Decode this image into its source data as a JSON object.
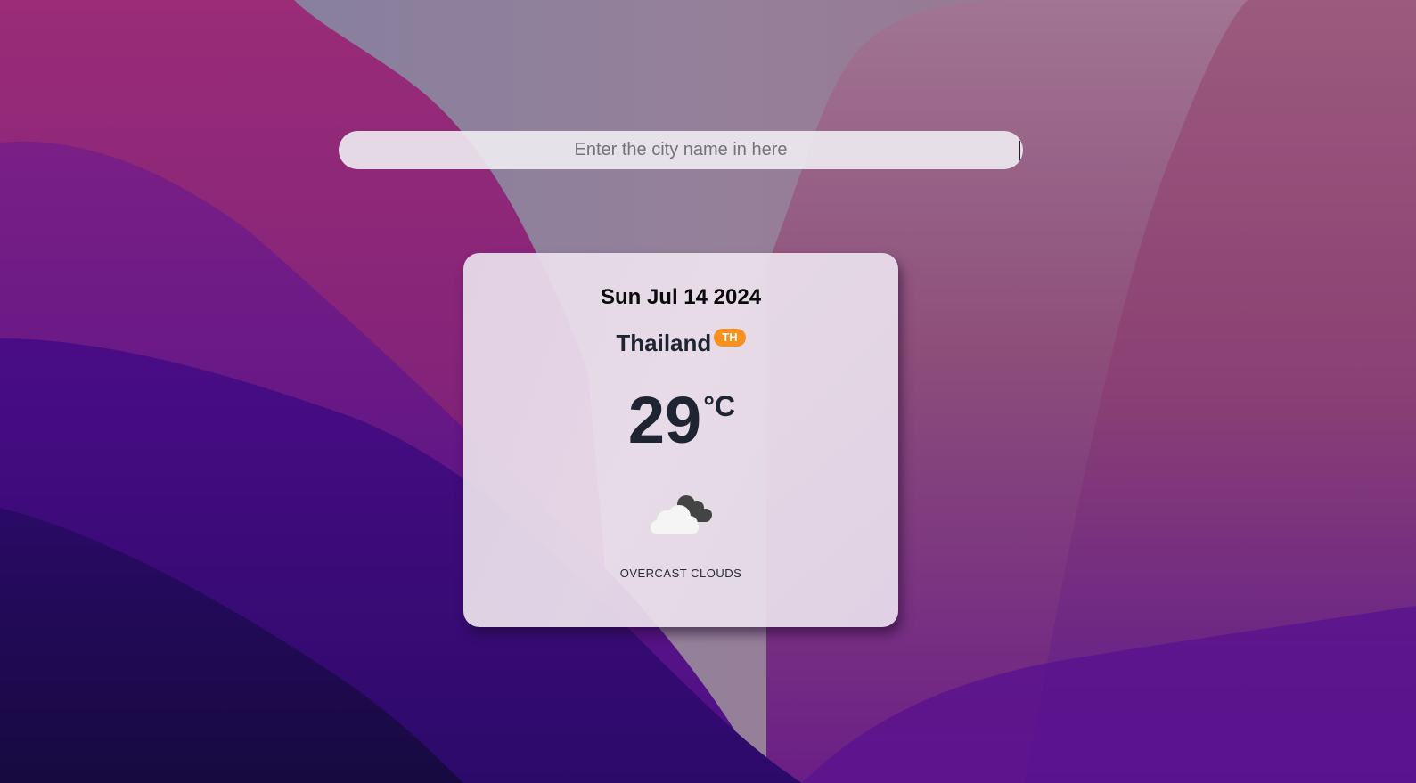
{
  "search": {
    "placeholder": "Enter the city name in here",
    "value": ""
  },
  "weather": {
    "date": "Sun Jul 14 2024",
    "country": "Thailand",
    "country_code": "TH",
    "temperature": "29",
    "unit": "°C",
    "icon": "overcast-clouds-icon",
    "description": "OVERCAST CLOUDS"
  },
  "colors": {
    "badge": "#f7901e",
    "text_dark": "#1f2433",
    "card_bg": "#ebe1ec"
  }
}
